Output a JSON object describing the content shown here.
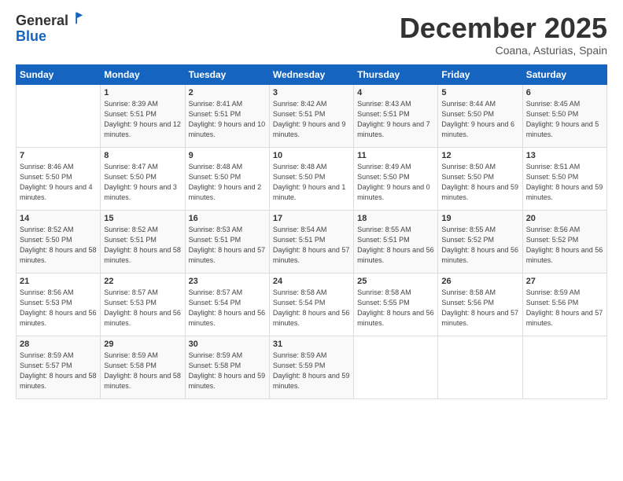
{
  "logo": {
    "general": "General",
    "blue": "Blue"
  },
  "header": {
    "month": "December 2025",
    "location": "Coana, Asturias, Spain"
  },
  "weekdays": [
    "Sunday",
    "Monday",
    "Tuesday",
    "Wednesday",
    "Thursday",
    "Friday",
    "Saturday"
  ],
  "weeks": [
    [
      {
        "day": "",
        "sunrise": "",
        "sunset": "",
        "daylight": ""
      },
      {
        "day": "1",
        "sunrise": "Sunrise: 8:39 AM",
        "sunset": "Sunset: 5:51 PM",
        "daylight": "Daylight: 9 hours and 12 minutes."
      },
      {
        "day": "2",
        "sunrise": "Sunrise: 8:41 AM",
        "sunset": "Sunset: 5:51 PM",
        "daylight": "Daylight: 9 hours and 10 minutes."
      },
      {
        "day": "3",
        "sunrise": "Sunrise: 8:42 AM",
        "sunset": "Sunset: 5:51 PM",
        "daylight": "Daylight: 9 hours and 9 minutes."
      },
      {
        "day": "4",
        "sunrise": "Sunrise: 8:43 AM",
        "sunset": "Sunset: 5:51 PM",
        "daylight": "Daylight: 9 hours and 7 minutes."
      },
      {
        "day": "5",
        "sunrise": "Sunrise: 8:44 AM",
        "sunset": "Sunset: 5:50 PM",
        "daylight": "Daylight: 9 hours and 6 minutes."
      },
      {
        "day": "6",
        "sunrise": "Sunrise: 8:45 AM",
        "sunset": "Sunset: 5:50 PM",
        "daylight": "Daylight: 9 hours and 5 minutes."
      }
    ],
    [
      {
        "day": "7",
        "sunrise": "Sunrise: 8:46 AM",
        "sunset": "Sunset: 5:50 PM",
        "daylight": "Daylight: 9 hours and 4 minutes."
      },
      {
        "day": "8",
        "sunrise": "Sunrise: 8:47 AM",
        "sunset": "Sunset: 5:50 PM",
        "daylight": "Daylight: 9 hours and 3 minutes."
      },
      {
        "day": "9",
        "sunrise": "Sunrise: 8:48 AM",
        "sunset": "Sunset: 5:50 PM",
        "daylight": "Daylight: 9 hours and 2 minutes."
      },
      {
        "day": "10",
        "sunrise": "Sunrise: 8:48 AM",
        "sunset": "Sunset: 5:50 PM",
        "daylight": "Daylight: 9 hours and 1 minute."
      },
      {
        "day": "11",
        "sunrise": "Sunrise: 8:49 AM",
        "sunset": "Sunset: 5:50 PM",
        "daylight": "Daylight: 9 hours and 0 minutes."
      },
      {
        "day": "12",
        "sunrise": "Sunrise: 8:50 AM",
        "sunset": "Sunset: 5:50 PM",
        "daylight": "Daylight: 8 hours and 59 minutes."
      },
      {
        "day": "13",
        "sunrise": "Sunrise: 8:51 AM",
        "sunset": "Sunset: 5:50 PM",
        "daylight": "Daylight: 8 hours and 59 minutes."
      }
    ],
    [
      {
        "day": "14",
        "sunrise": "Sunrise: 8:52 AM",
        "sunset": "Sunset: 5:50 PM",
        "daylight": "Daylight: 8 hours and 58 minutes."
      },
      {
        "day": "15",
        "sunrise": "Sunrise: 8:52 AM",
        "sunset": "Sunset: 5:51 PM",
        "daylight": "Daylight: 8 hours and 58 minutes."
      },
      {
        "day": "16",
        "sunrise": "Sunrise: 8:53 AM",
        "sunset": "Sunset: 5:51 PM",
        "daylight": "Daylight: 8 hours and 57 minutes."
      },
      {
        "day": "17",
        "sunrise": "Sunrise: 8:54 AM",
        "sunset": "Sunset: 5:51 PM",
        "daylight": "Daylight: 8 hours and 57 minutes."
      },
      {
        "day": "18",
        "sunrise": "Sunrise: 8:55 AM",
        "sunset": "Sunset: 5:51 PM",
        "daylight": "Daylight: 8 hours and 56 minutes."
      },
      {
        "day": "19",
        "sunrise": "Sunrise: 8:55 AM",
        "sunset": "Sunset: 5:52 PM",
        "daylight": "Daylight: 8 hours and 56 minutes."
      },
      {
        "day": "20",
        "sunrise": "Sunrise: 8:56 AM",
        "sunset": "Sunset: 5:52 PM",
        "daylight": "Daylight: 8 hours and 56 minutes."
      }
    ],
    [
      {
        "day": "21",
        "sunrise": "Sunrise: 8:56 AM",
        "sunset": "Sunset: 5:53 PM",
        "daylight": "Daylight: 8 hours and 56 minutes."
      },
      {
        "day": "22",
        "sunrise": "Sunrise: 8:57 AM",
        "sunset": "Sunset: 5:53 PM",
        "daylight": "Daylight: 8 hours and 56 minutes."
      },
      {
        "day": "23",
        "sunrise": "Sunrise: 8:57 AM",
        "sunset": "Sunset: 5:54 PM",
        "daylight": "Daylight: 8 hours and 56 minutes."
      },
      {
        "day": "24",
        "sunrise": "Sunrise: 8:58 AM",
        "sunset": "Sunset: 5:54 PM",
        "daylight": "Daylight: 8 hours and 56 minutes."
      },
      {
        "day": "25",
        "sunrise": "Sunrise: 8:58 AM",
        "sunset": "Sunset: 5:55 PM",
        "daylight": "Daylight: 8 hours and 56 minutes."
      },
      {
        "day": "26",
        "sunrise": "Sunrise: 8:58 AM",
        "sunset": "Sunset: 5:56 PM",
        "daylight": "Daylight: 8 hours and 57 minutes."
      },
      {
        "day": "27",
        "sunrise": "Sunrise: 8:59 AM",
        "sunset": "Sunset: 5:56 PM",
        "daylight": "Daylight: 8 hours and 57 minutes."
      }
    ],
    [
      {
        "day": "28",
        "sunrise": "Sunrise: 8:59 AM",
        "sunset": "Sunset: 5:57 PM",
        "daylight": "Daylight: 8 hours and 58 minutes."
      },
      {
        "day": "29",
        "sunrise": "Sunrise: 8:59 AM",
        "sunset": "Sunset: 5:58 PM",
        "daylight": "Daylight: 8 hours and 58 minutes."
      },
      {
        "day": "30",
        "sunrise": "Sunrise: 8:59 AM",
        "sunset": "Sunset: 5:58 PM",
        "daylight": "Daylight: 8 hours and 59 minutes."
      },
      {
        "day": "31",
        "sunrise": "Sunrise: 8:59 AM",
        "sunset": "Sunset: 5:59 PM",
        "daylight": "Daylight: 8 hours and 59 minutes."
      },
      {
        "day": "",
        "sunrise": "",
        "sunset": "",
        "daylight": ""
      },
      {
        "day": "",
        "sunrise": "",
        "sunset": "",
        "daylight": ""
      },
      {
        "day": "",
        "sunrise": "",
        "sunset": "",
        "daylight": ""
      }
    ]
  ]
}
